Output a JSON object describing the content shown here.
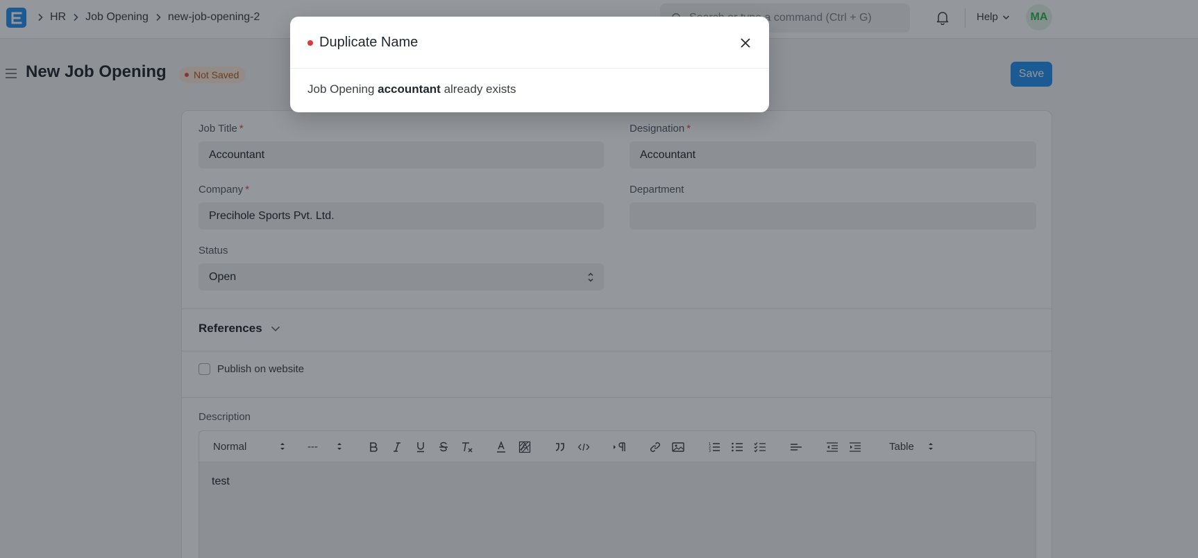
{
  "navbar": {
    "breadcrumbs": [
      "HR",
      "Job Opening",
      "new-job-opening-2"
    ],
    "search_placeholder": "Search or type a command (Ctrl + G)",
    "help_label": "Help",
    "avatar_initials": "MA"
  },
  "page": {
    "title": "New Job Opening",
    "status": "Not Saved",
    "save_label": "Save"
  },
  "form": {
    "job_title_label": "Job Title",
    "job_title_value": "Accountant",
    "designation_label": "Designation",
    "designation_value": "Accountant",
    "company_label": "Company",
    "company_value": "Precihole Sports Pvt. Ltd.",
    "department_label": "Department",
    "department_value": "",
    "status_label": "Status",
    "status_value": "Open",
    "references_label": "References",
    "publish_label": "Publish on website",
    "description_label": "Description",
    "description_value": "test",
    "toolbar": {
      "paragraph_style": "Normal",
      "font_size": "---",
      "table_label": "Table"
    }
  },
  "modal": {
    "title": "Duplicate Name",
    "message_prefix": "Job Opening",
    "message_bold": "accountant",
    "message_suffix": "already exists"
  },
  "colors": {
    "primary": "#2490ef",
    "error": "#e03636",
    "not_saved_bg": "#fdeadb",
    "not_saved_text": "#b65a14"
  }
}
